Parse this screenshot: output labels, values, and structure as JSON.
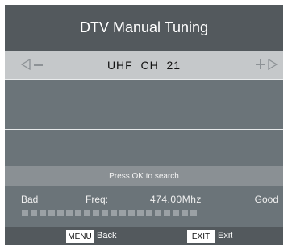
{
  "title": "DTV Manual Tuning",
  "channel": {
    "label": "UHF  CH  21",
    "left_icon": "arrow-left-icon",
    "minus_icon": "minus-icon",
    "plus_icon": "plus-icon",
    "right_icon": "arrow-right-icon"
  },
  "hint": "Press OK to search",
  "signal": {
    "bad_label": "Bad",
    "freq_label": "Freq:",
    "freq_value": "474.00Mhz",
    "good_label": "Good",
    "segments_total": 20,
    "segments_active": 0
  },
  "footer": {
    "menu_key": "MENU",
    "menu_action": "Back",
    "exit_key": "EXIT",
    "exit_action": "Exit"
  },
  "colors": {
    "title_bg": "#53595d",
    "panel_bg": "#6b7479",
    "channel_bar_bg": "#c5c8ca",
    "hint_bg": "#8a9094"
  }
}
